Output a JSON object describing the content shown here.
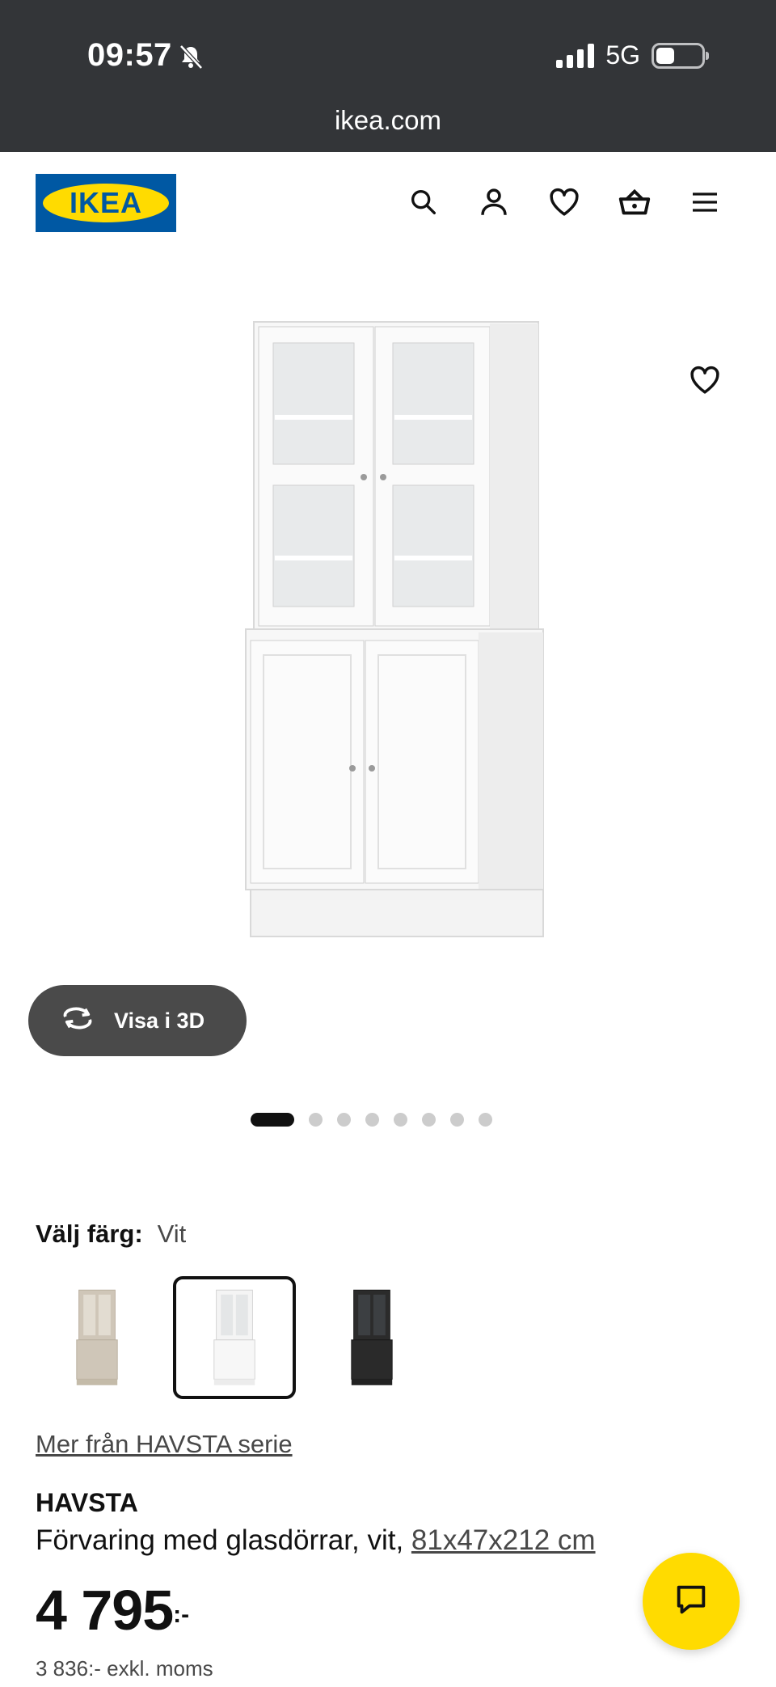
{
  "status_bar": {
    "time": "09:57",
    "network": "5G",
    "url": "ikea.com"
  },
  "header": {
    "logo_text": "IKEA",
    "icons": [
      "search-icon",
      "account-icon",
      "heart-icon",
      "basket-icon",
      "menu-icon"
    ]
  },
  "gallery": {
    "view_3d_label": "Visa i 3D",
    "image_count": 8,
    "active_index": 0
  },
  "color": {
    "label": "Välj färg:",
    "selected": "Vit"
  },
  "product": {
    "series_link": "Mer från HAVSTA serie",
    "name": "HAVSTA",
    "description": "Förvaring med glasdörrar, vit,",
    "dimensions": "81x47x212 cm",
    "price": "4 795",
    "price_suffix": ":-",
    "price_excl_vat": "3 836:- exkl. moms"
  },
  "colors": {
    "brand_blue": "#0058a3",
    "brand_yellow": "#ffdb00",
    "status_bar": "#333538"
  }
}
